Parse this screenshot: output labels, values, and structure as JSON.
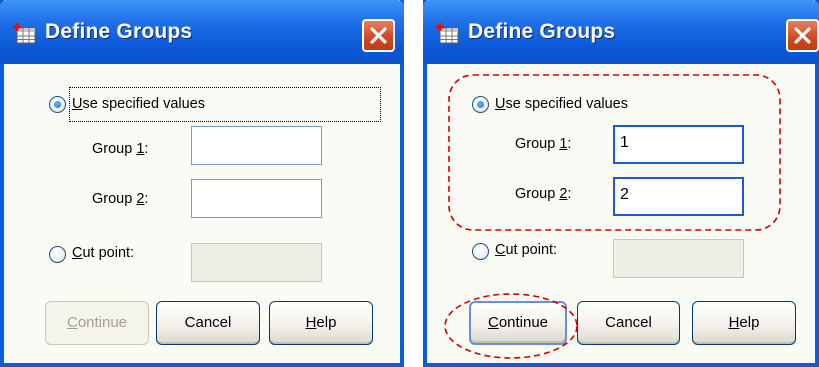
{
  "dialog_left": {
    "title": "Define Groups",
    "radio_specified": {
      "label": "Use specified values",
      "checked": true
    },
    "group1": {
      "label": "Group 1:",
      "value": ""
    },
    "group2": {
      "label": "Group 2:",
      "value": ""
    },
    "radio_cut": {
      "label": "Cut point:",
      "checked": false
    },
    "cut_value": "",
    "buttons": {
      "continue": "Continue",
      "cancel": "Cancel",
      "help": "Help"
    },
    "continue_enabled": false
  },
  "dialog_right": {
    "title": "Define Groups",
    "radio_specified": {
      "label": "Use specified values",
      "checked": true
    },
    "group1": {
      "label": "Group 1:",
      "value": "1"
    },
    "group2": {
      "label": "Group 2:",
      "value": "2"
    },
    "radio_cut": {
      "label": "Cut point:",
      "checked": false
    },
    "cut_value": "",
    "buttons": {
      "continue": "Continue",
      "cancel": "Cancel",
      "help": "Help"
    },
    "continue_enabled": true
  },
  "colors": {
    "titlebar": "#0a58d6",
    "close": "#d04a23",
    "annotation": "#d40000"
  }
}
